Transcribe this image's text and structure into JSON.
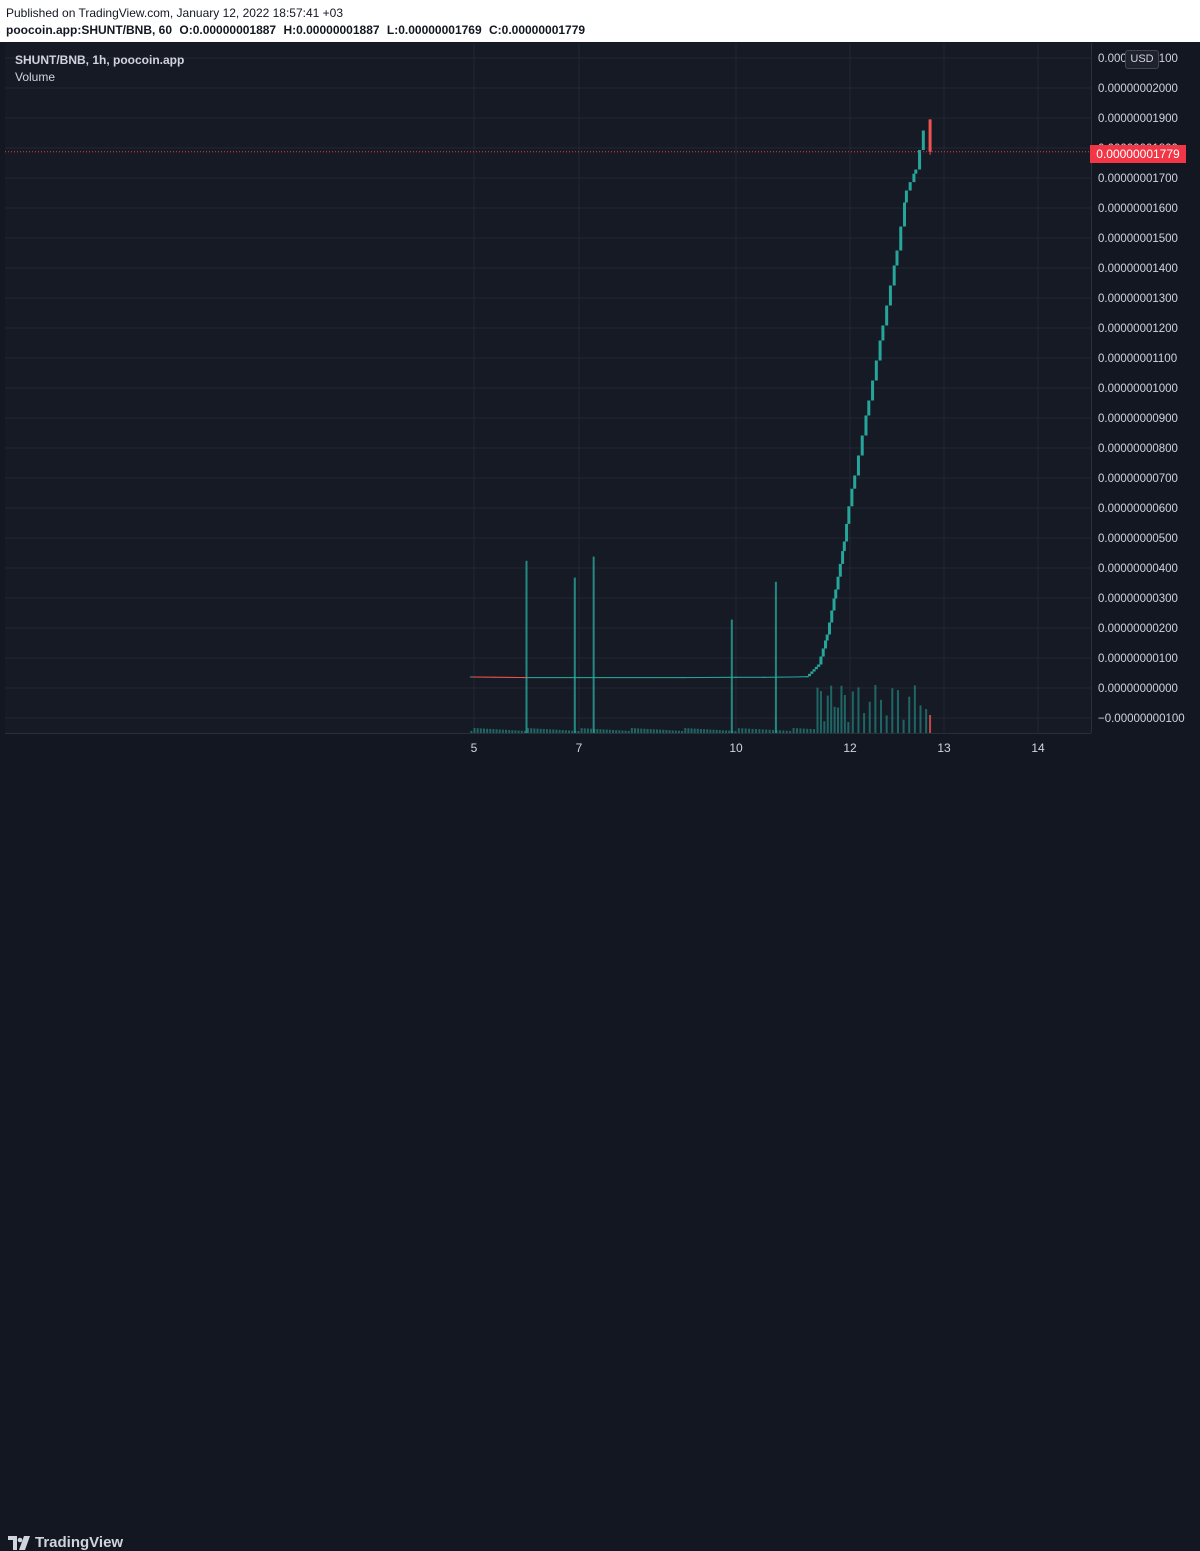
{
  "header": {
    "published": "Published on TradingView.com, January 12, 2022 18:57:41 +03",
    "symbol_line": "poocoin.app:SHUNT/BNB, 60",
    "open": "O:0.00000001887",
    "high": "H:0.00000001887",
    "low": "L:0.00000001769",
    "close": "C:0.00000001779"
  },
  "legend": {
    "symbol": "SHUNT/BNB, 1h, poocoin.app",
    "volume": "Volume"
  },
  "price_axis": {
    "currency": "USD",
    "last_price": "0.00000001779",
    "tick_labels": [
      "0.00000002100",
      "0.00000002000",
      "0.00000001900",
      "0.00000001800",
      "0.00000001700",
      "0.00000001600",
      "0.00000001500",
      "0.00000001400",
      "0.00000001300",
      "0.00000001200",
      "0.00000001100",
      "0.00000001000",
      "0.00000000900",
      "0.00000000800",
      "0.00000000700",
      "0.00000000600",
      "0.00000000500",
      "0.00000000400",
      "0.00000000300",
      "0.00000000200",
      "0.00000000100",
      "0.00000000000",
      "−0.00000000100"
    ]
  },
  "time_axis": {
    "tick_labels": [
      "5",
      "7",
      "10",
      "12",
      "13",
      "14"
    ]
  },
  "footer": {
    "brand": "TradingView"
  },
  "colors": {
    "up": "#26a69a",
    "down": "#ef5350",
    "last_price": "#f23645",
    "grid": "#232733",
    "background": "#161a25"
  },
  "chart_data": {
    "type": "candlestick",
    "interval": "1h",
    "x_ticks": [
      "5",
      "7",
      "10",
      "12",
      "13",
      "14"
    ],
    "y_unit": "BNB",
    "price_series": [
      {
        "day": 4.95,
        "close": 3e-10
      },
      {
        "day": 6.0,
        "close": 2.8e-10
      },
      {
        "day": 7.0,
        "close": 2.8e-10
      },
      {
        "day": 8.0,
        "close": 2.8e-10
      },
      {
        "day": 9.0,
        "close": 2.8e-10
      },
      {
        "day": 10.0,
        "close": 2.9e-10
      },
      {
        "day": 10.5,
        "close": 2.9e-10
      },
      {
        "day": 11.0,
        "close": 3e-10
      },
      {
        "day": 11.25,
        "close": 3.1e-10
      },
      {
        "day": 11.45,
        "close": 7e-10
      },
      {
        "day": 11.6,
        "close": 1.7e-09
      },
      {
        "day": 11.75,
        "close": 3.2e-09
      },
      {
        "day": 11.9,
        "close": 4.8e-09
      },
      {
        "day": 12.05,
        "close": 7e-09
      },
      {
        "day": 12.2,
        "close": 9.5e-09
      },
      {
        "day": 12.35,
        "close": 1.2e-08
      },
      {
        "day": 12.5,
        "close": 1.45e-08
      },
      {
        "day": 12.6,
        "close": 1.65e-08
      },
      {
        "day": 12.7,
        "close": 1.72e-08
      },
      {
        "day": 12.78,
        "close": 1.85e-08
      },
      {
        "day": 12.82,
        "open": 1.887e-08,
        "high": 1.887e-08,
        "low": 1.769e-08,
        "close": 1.779e-08
      }
    ],
    "volume_spikes": [
      {
        "day": 6.0,
        "relative": 0.41
      },
      {
        "day": 6.92,
        "relative": 0.37
      },
      {
        "day": 7.28,
        "relative": 0.42
      },
      {
        "day": 9.92,
        "relative": 0.27
      },
      {
        "day": 10.7,
        "relative": 0.36
      }
    ],
    "last_price": 1.779e-08
  }
}
